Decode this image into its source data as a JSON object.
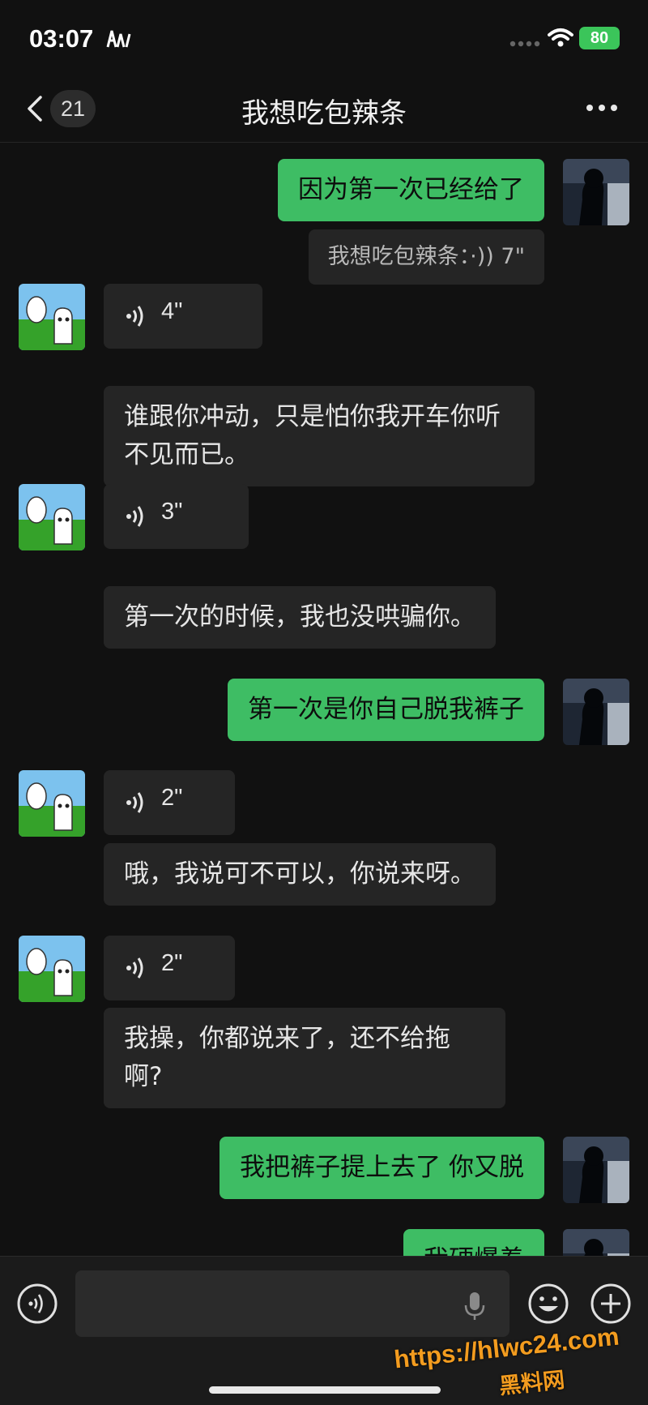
{
  "status_bar": {
    "time": "03:07",
    "battery": "80"
  },
  "header": {
    "back_count": "21",
    "title": "我想吃包辣条"
  },
  "messages": [
    {
      "side": "right",
      "type": "text",
      "text": "因为第一次已经给了"
    },
    {
      "side": "right",
      "type": "transcript",
      "text": "我想吃包辣条：·)) 7\""
    },
    {
      "side": "left",
      "type": "voice",
      "duration": "4\""
    },
    {
      "side": "left",
      "type": "text",
      "text": "谁跟你冲动，只是怕你我开车你听不见而已。"
    },
    {
      "side": "left",
      "type": "voice",
      "duration": "3\""
    },
    {
      "side": "left",
      "type": "text",
      "text": "第一次的时候，我也没哄骗你。"
    },
    {
      "side": "right",
      "type": "text",
      "text": "第一次是你自己脱我裤子"
    },
    {
      "side": "left",
      "type": "voice",
      "duration": "2\""
    },
    {
      "side": "left",
      "type": "text",
      "text": "哦，我说可不可以，你说来呀。"
    },
    {
      "side": "left",
      "type": "voice",
      "duration": "2\""
    },
    {
      "side": "left",
      "type": "text",
      "text": "我操，你都说来了，还不给拖啊?"
    },
    {
      "side": "right",
      "type": "text",
      "text": "我把裤子提上去了 你又脱"
    },
    {
      "side": "right",
      "type": "text",
      "text": "我硬爆着"
    }
  ],
  "watermark": {
    "url": "https://hlwc24.com",
    "name": "黑料网"
  },
  "colors": {
    "outgoing_bubble": "#3ebd64",
    "incoming_bubble": "#252525",
    "background": "#111111",
    "watermark": "#f39c1f"
  }
}
